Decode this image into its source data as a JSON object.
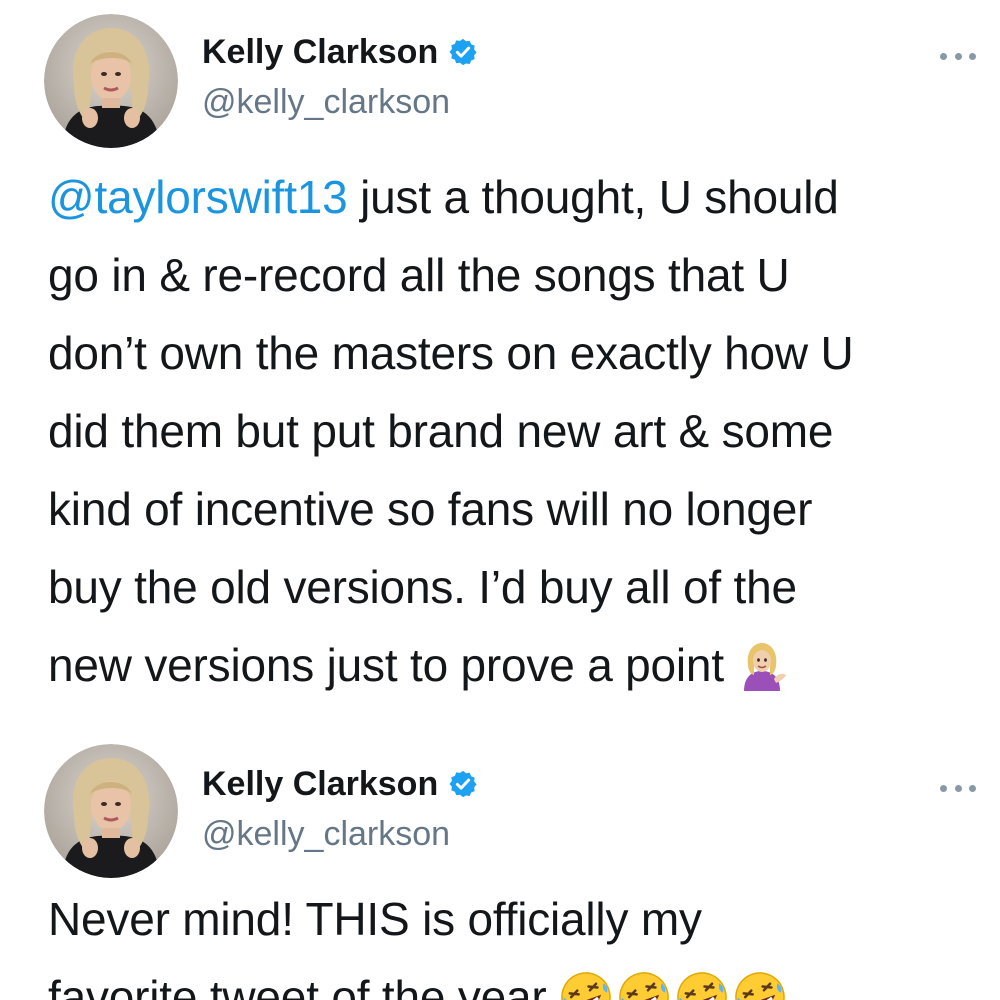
{
  "tweets": [
    {
      "author": {
        "display_name": "Kelly Clarkson",
        "handle": "@kelly_clarkson",
        "verified": true,
        "avatar_icon": "profile-photo"
      },
      "more_icon": "more-options-icon",
      "mention": "@taylorswift13",
      "lines": [
        " just a thought, U should",
        "go in & re-record all the songs that U",
        "don’t own the masters on exactly how U",
        "did them but put brand new art & some",
        "kind of incentive so fans will no longer",
        "buy the old versions. I’d buy all of the",
        "new versions just to prove a point "
      ],
      "trailing_emoji": "woman-tipping-hand-emoji"
    },
    {
      "author": {
        "display_name": "Kelly Clarkson",
        "handle": "@kelly_clarkson",
        "verified": true,
        "avatar_icon": "profile-photo"
      },
      "more_icon": "more-options-icon",
      "lines": [
        "Never mind! THIS is officially my",
        "favorite tweet of the year "
      ],
      "trailing_emoji": "rolling-on-the-floor-laughing-emoji",
      "trailing_emoji_count": 4
    }
  ],
  "colors": {
    "link": "#1b95e0",
    "verified_badge": "#1da1f2",
    "handle": "#657786",
    "text": "#14171a"
  }
}
